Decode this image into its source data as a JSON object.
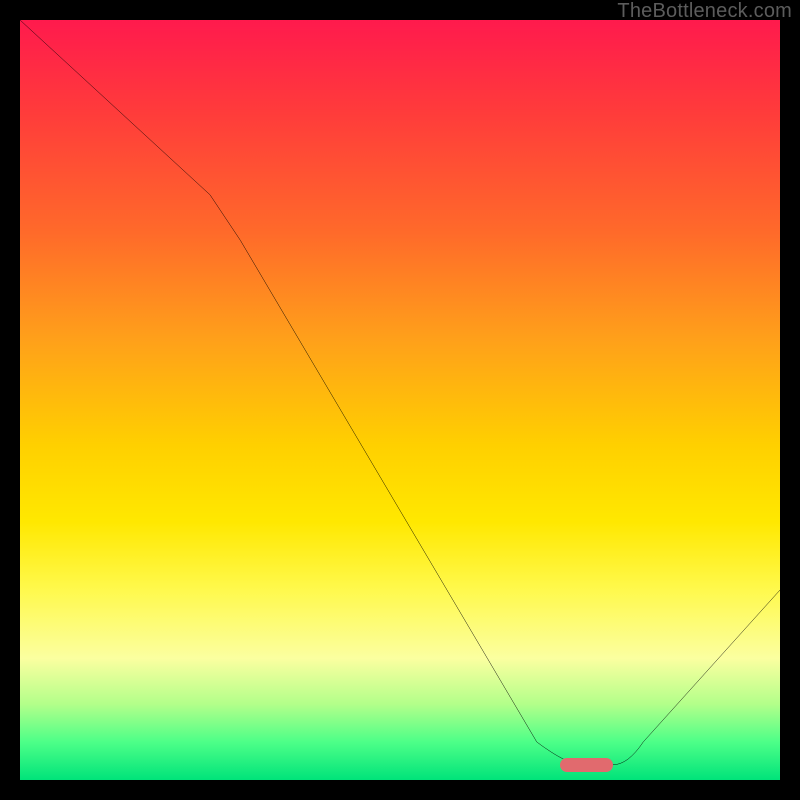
{
  "watermark": "TheBottleneck.com",
  "chart_data": {
    "type": "line",
    "title": "",
    "xlabel": "",
    "ylabel": "",
    "xlim": [
      0,
      100
    ],
    "ylim": [
      0,
      100
    ],
    "grid": false,
    "legend": false,
    "series": [
      {
        "name": "bottleneck-curve",
        "x": [
          0,
          25,
          72,
          78,
          100
        ],
        "y": [
          100,
          77,
          2,
          2,
          25
        ]
      }
    ],
    "marker": {
      "name": "current-config",
      "x_start": 71,
      "x_end": 78,
      "y": 2,
      "color": "#e16a6e"
    },
    "background_gradient": {
      "top": "#ff1a4d",
      "mid": "#ffe800",
      "bottom": "#00e37a"
    }
  },
  "colors": {
    "frame": "#000000",
    "curve": "#000000",
    "marker": "#e16a6e",
    "watermark": "#5c5c5c"
  }
}
